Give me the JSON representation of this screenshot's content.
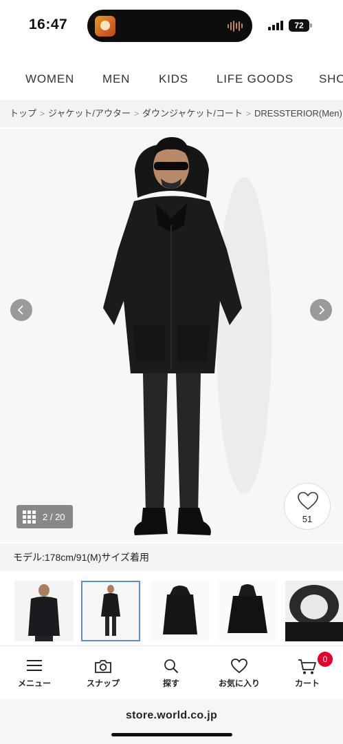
{
  "status_bar": {
    "time": "16:47",
    "battery": "72"
  },
  "category_nav": {
    "items": [
      "WOMEN",
      "MEN",
      "KIDS",
      "LIFE GOODS",
      "SHO"
    ]
  },
  "breadcrumb": {
    "items": [
      "トップ",
      "ジャケット/アウター",
      "ダウンジャケット/コート",
      "DRESSTERIOR(Men)"
    ]
  },
  "gallery": {
    "counter": "2 / 20",
    "favorite_count": "51"
  },
  "model_info": "モデル:178cm/91(M)サイズ着用",
  "tab_bar": {
    "items": [
      {
        "label": "メニュー",
        "icon": "hamburger-menu-icon"
      },
      {
        "label": "スナップ",
        "icon": "camera-icon"
      },
      {
        "label": "探す",
        "icon": "search-icon"
      },
      {
        "label": "お気に入り",
        "icon": "heart-icon"
      },
      {
        "label": "カート",
        "icon": "cart-icon"
      }
    ],
    "cart_badge": "0"
  },
  "browser": {
    "url": "store.world.co.jp"
  },
  "colors": {
    "accent": "#e3002d",
    "thumb_selected": "#5b8fc7",
    "arrow_bg": "#9a9a9a"
  }
}
